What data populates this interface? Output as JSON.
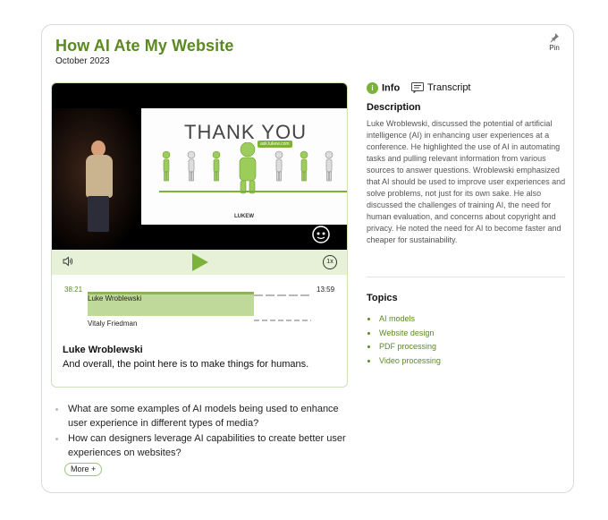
{
  "header": {
    "title": "How AI Ate My Website",
    "date": "October 2023",
    "pin_label": "Pin"
  },
  "video": {
    "slide_title": "THANK YOU",
    "slide_url": "ask.lukew.com",
    "slide_logo": "LUKEW",
    "speed_label": "1x"
  },
  "timeline": {
    "current_time": "38:21",
    "end_time": "13:59",
    "active_speaker": "Luke Wroblewski",
    "other_speaker": "Vitaly Friedman"
  },
  "quote": {
    "speaker": "Luke Wroblewski",
    "text": "And overall, the point here is to make things for humans."
  },
  "questions": [
    "What are some examples of AI models being used to enhance user experience in different types of media?",
    "How can designers leverage AI capabilities to create better user experiences on websites?"
  ],
  "more_label": "More +",
  "tabs": {
    "info": "Info",
    "transcript": "Transcript"
  },
  "description": {
    "heading": "Description",
    "text": "Luke Wroblewski, discussed the potential of artificial intelligence (AI) in enhancing user experiences at a conference. He highlighted the use of AI in automating tasks and pulling relevant information from various sources to answer questions. Wroblewski emphasized that AI should be used to improve user experiences and solve problems, not just for its own sake. He also discussed the challenges of training AI, the need for human evaluation, and concerns about copyright and privacy. He noted the need for AI to become faster and cheaper for sustainability."
  },
  "topics": {
    "heading": "Topics",
    "items": [
      "AI models",
      "Website design",
      "PDF processing",
      "Video processing"
    ]
  },
  "colors": {
    "accent": "#5a8a1f",
    "accent_light": "#e7f1d7",
    "segment": "#bfd99b"
  },
  "icons": [
    "pin-icon",
    "info-icon",
    "transcript-icon",
    "volume-icon",
    "play-icon"
  ]
}
